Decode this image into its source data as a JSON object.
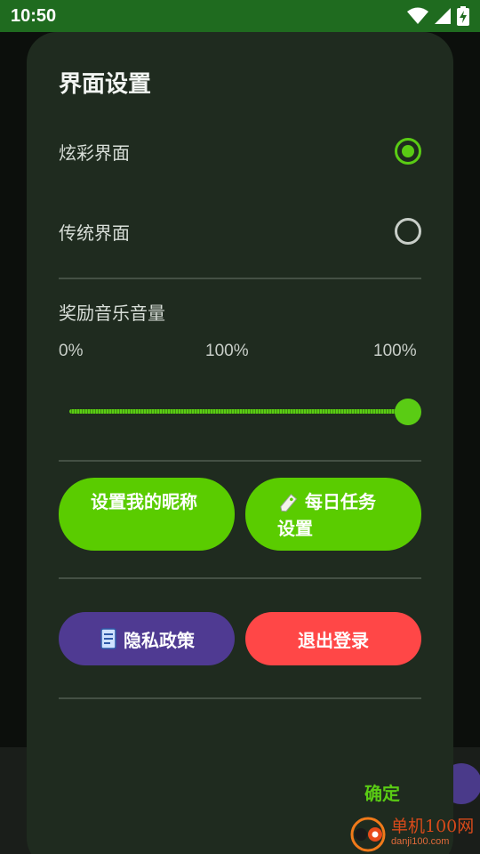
{
  "status_bar": {
    "time": "10:50",
    "icons": [
      "wifi-icon",
      "signal-icon",
      "battery-charging-icon"
    ]
  },
  "dialog": {
    "title": "界面设置",
    "options": [
      {
        "label": "炫彩界面",
        "selected": true
      },
      {
        "label": "传统界面",
        "selected": false
      }
    ],
    "volume": {
      "label": "奖励音乐音量",
      "min_label": "0%",
      "current_label": "100%",
      "max_label": "100%",
      "value": 1.0
    },
    "buttons": {
      "nickname": "设置我的昵称",
      "daily_task": "每日任务设置",
      "daily_task_icon": "tag-icon",
      "privacy": "隐私政策",
      "privacy_icon": "document-icon",
      "logout": "退出登录"
    },
    "confirm": "确定"
  },
  "watermark": {
    "cn": "单机100网",
    "en": "danji100.com"
  },
  "colors": {
    "accent": "#5acc14",
    "dialog_bg": "#1f2b1f",
    "status_bar": "#1f6b1f",
    "purple": "#4f3a92",
    "red": "#ff4747"
  }
}
